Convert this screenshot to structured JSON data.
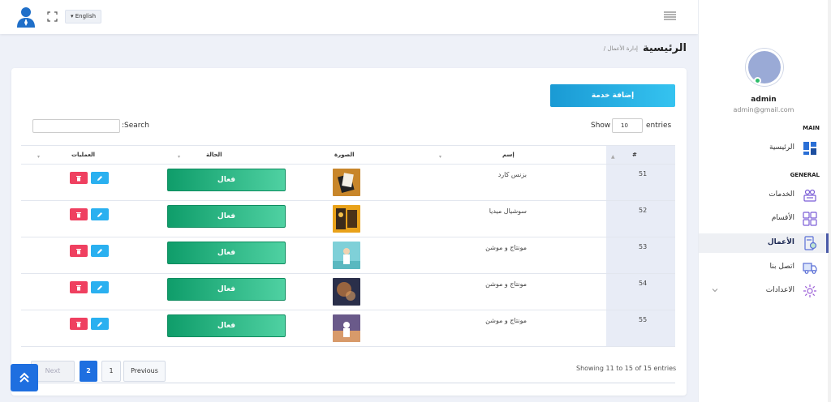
{
  "topbar": {
    "language": "English"
  },
  "sidebar": {
    "profile_name": "admin",
    "profile_email": "admin@gmail.com",
    "section_main": "MAIN",
    "section_general": "GENERAL",
    "items": [
      {
        "label": "الرئيسية"
      },
      {
        "label": "الخدمات"
      },
      {
        "label": "الأقسام"
      },
      {
        "label": "الأعمال"
      },
      {
        "label": "اتصل بنا"
      },
      {
        "label": "الاعدادات"
      }
    ]
  },
  "breadcrumb": {
    "title": "الرئيسية",
    "path": "/ إدارة الأعمال"
  },
  "toolbar": {
    "add_label": "إضافة خدمة",
    "search_label": ":Search",
    "show_label": "Show",
    "entries_value": "10",
    "entries_label": "entries"
  },
  "table": {
    "headers": {
      "hash": "#",
      "name": "إسم",
      "image": "الصورة",
      "status": "الحالة",
      "actions": "العمليات"
    },
    "rows": [
      {
        "num": "51",
        "name": "بزنس كارد",
        "status": "فعال"
      },
      {
        "num": "52",
        "name": "سوشيال ميديا",
        "status": "فعال"
      },
      {
        "num": "53",
        "name": "مونتاج و موشن",
        "status": "فعال"
      },
      {
        "num": "54",
        "name": "مونتاج و موشن",
        "status": "فعال"
      },
      {
        "num": "55",
        "name": "مونتاج و موشن",
        "status": "فعال"
      }
    ]
  },
  "footer": {
    "info": "Showing 11 to 15 of 15 entries",
    "next": "Next",
    "page2": "2",
    "page1": "1",
    "previous": "Previous"
  },
  "colors": {
    "accent": "#1e6fe0",
    "status_green": "#0f9d6a",
    "delete_red": "#ef4060",
    "edit_blue": "#2ab0f0"
  }
}
